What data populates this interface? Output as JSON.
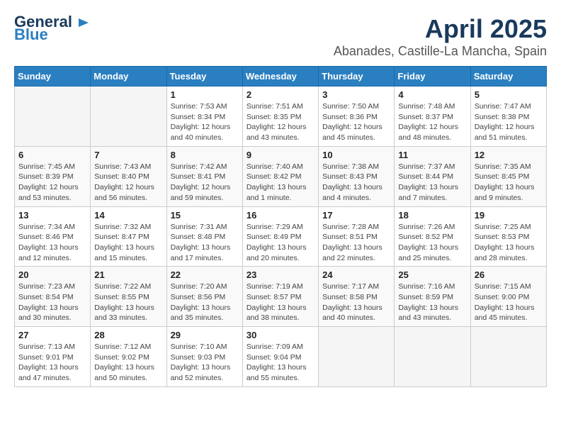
{
  "header": {
    "logo_general": "General",
    "logo_blue": "Blue",
    "title": "April 2025",
    "subtitle": "Abanades, Castille-La Mancha, Spain"
  },
  "calendar": {
    "weekdays": [
      "Sunday",
      "Monday",
      "Tuesday",
      "Wednesday",
      "Thursday",
      "Friday",
      "Saturday"
    ],
    "weeks": [
      [
        {
          "day": "",
          "info": ""
        },
        {
          "day": "",
          "info": ""
        },
        {
          "day": "1",
          "info": "Sunrise: 7:53 AM\nSunset: 8:34 PM\nDaylight: 12 hours\nand 40 minutes."
        },
        {
          "day": "2",
          "info": "Sunrise: 7:51 AM\nSunset: 8:35 PM\nDaylight: 12 hours\nand 43 minutes."
        },
        {
          "day": "3",
          "info": "Sunrise: 7:50 AM\nSunset: 8:36 PM\nDaylight: 12 hours\nand 45 minutes."
        },
        {
          "day": "4",
          "info": "Sunrise: 7:48 AM\nSunset: 8:37 PM\nDaylight: 12 hours\nand 48 minutes."
        },
        {
          "day": "5",
          "info": "Sunrise: 7:47 AM\nSunset: 8:38 PM\nDaylight: 12 hours\nand 51 minutes."
        }
      ],
      [
        {
          "day": "6",
          "info": "Sunrise: 7:45 AM\nSunset: 8:39 PM\nDaylight: 12 hours\nand 53 minutes."
        },
        {
          "day": "7",
          "info": "Sunrise: 7:43 AM\nSunset: 8:40 PM\nDaylight: 12 hours\nand 56 minutes."
        },
        {
          "day": "8",
          "info": "Sunrise: 7:42 AM\nSunset: 8:41 PM\nDaylight: 12 hours\nand 59 minutes."
        },
        {
          "day": "9",
          "info": "Sunrise: 7:40 AM\nSunset: 8:42 PM\nDaylight: 13 hours\nand 1 minute."
        },
        {
          "day": "10",
          "info": "Sunrise: 7:38 AM\nSunset: 8:43 PM\nDaylight: 13 hours\nand 4 minutes."
        },
        {
          "day": "11",
          "info": "Sunrise: 7:37 AM\nSunset: 8:44 PM\nDaylight: 13 hours\nand 7 minutes."
        },
        {
          "day": "12",
          "info": "Sunrise: 7:35 AM\nSunset: 8:45 PM\nDaylight: 13 hours\nand 9 minutes."
        }
      ],
      [
        {
          "day": "13",
          "info": "Sunrise: 7:34 AM\nSunset: 8:46 PM\nDaylight: 13 hours\nand 12 minutes."
        },
        {
          "day": "14",
          "info": "Sunrise: 7:32 AM\nSunset: 8:47 PM\nDaylight: 13 hours\nand 15 minutes."
        },
        {
          "day": "15",
          "info": "Sunrise: 7:31 AM\nSunset: 8:48 PM\nDaylight: 13 hours\nand 17 minutes."
        },
        {
          "day": "16",
          "info": "Sunrise: 7:29 AM\nSunset: 8:49 PM\nDaylight: 13 hours\nand 20 minutes."
        },
        {
          "day": "17",
          "info": "Sunrise: 7:28 AM\nSunset: 8:51 PM\nDaylight: 13 hours\nand 22 minutes."
        },
        {
          "day": "18",
          "info": "Sunrise: 7:26 AM\nSunset: 8:52 PM\nDaylight: 13 hours\nand 25 minutes."
        },
        {
          "day": "19",
          "info": "Sunrise: 7:25 AM\nSunset: 8:53 PM\nDaylight: 13 hours\nand 28 minutes."
        }
      ],
      [
        {
          "day": "20",
          "info": "Sunrise: 7:23 AM\nSunset: 8:54 PM\nDaylight: 13 hours\nand 30 minutes."
        },
        {
          "day": "21",
          "info": "Sunrise: 7:22 AM\nSunset: 8:55 PM\nDaylight: 13 hours\nand 33 minutes."
        },
        {
          "day": "22",
          "info": "Sunrise: 7:20 AM\nSunset: 8:56 PM\nDaylight: 13 hours\nand 35 minutes."
        },
        {
          "day": "23",
          "info": "Sunrise: 7:19 AM\nSunset: 8:57 PM\nDaylight: 13 hours\nand 38 minutes."
        },
        {
          "day": "24",
          "info": "Sunrise: 7:17 AM\nSunset: 8:58 PM\nDaylight: 13 hours\nand 40 minutes."
        },
        {
          "day": "25",
          "info": "Sunrise: 7:16 AM\nSunset: 8:59 PM\nDaylight: 13 hours\nand 43 minutes."
        },
        {
          "day": "26",
          "info": "Sunrise: 7:15 AM\nSunset: 9:00 PM\nDaylight: 13 hours\nand 45 minutes."
        }
      ],
      [
        {
          "day": "27",
          "info": "Sunrise: 7:13 AM\nSunset: 9:01 PM\nDaylight: 13 hours\nand 47 minutes."
        },
        {
          "day": "28",
          "info": "Sunrise: 7:12 AM\nSunset: 9:02 PM\nDaylight: 13 hours\nand 50 minutes."
        },
        {
          "day": "29",
          "info": "Sunrise: 7:10 AM\nSunset: 9:03 PM\nDaylight: 13 hours\nand 52 minutes."
        },
        {
          "day": "30",
          "info": "Sunrise: 7:09 AM\nSunset: 9:04 PM\nDaylight: 13 hours\nand 55 minutes."
        },
        {
          "day": "",
          "info": ""
        },
        {
          "day": "",
          "info": ""
        },
        {
          "day": "",
          "info": ""
        }
      ]
    ]
  }
}
